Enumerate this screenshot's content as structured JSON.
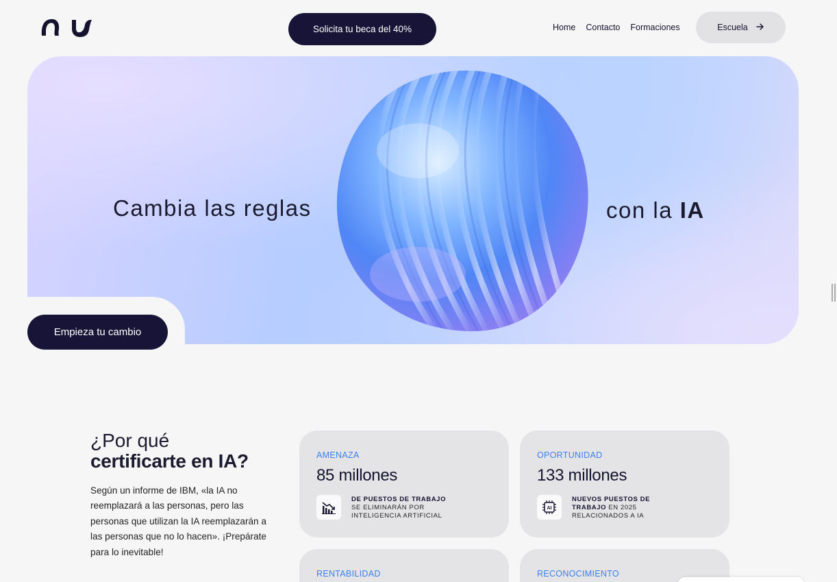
{
  "header": {
    "cta_label": "Solicita tu beca del 40%",
    "nav": [
      "Home",
      "Contacto",
      "Formaciones"
    ],
    "escuela_label": "Escuela",
    "escuela_icon": "arrow-right-icon"
  },
  "hero": {
    "left_text": "Cambia las reglas",
    "right_text_prefix": "con la",
    "right_text_bold": "IA",
    "cta_label": "Empieza tu cambio"
  },
  "why": {
    "title_line1": "¿Por qué",
    "title_line2": "certificarte en IA?",
    "text": "Según un informe de IBM, «la IA no reemplazará a las personas, pero las personas que utilizan la IA reemplazarán a las personas que no lo hacen». ¡Prepárate para lo inevitable!"
  },
  "cards": [
    {
      "tag": "AMENAZA",
      "value": "85 millones",
      "icon": "chart-down-icon",
      "desc_bold": "DE PUESTOS DE TRABAJO",
      "desc_rest": "SE ELIMINARÁN POR INTELIGENCIA ARTIFICIAL"
    },
    {
      "tag": "OPORTUNIDAD",
      "value": "133 millones",
      "icon": "ai-chip-icon",
      "desc_bold": "NUEVOS PUESTOS DE TRABAJO",
      "desc_rest": "EN 2025 RELACIONADOS A IA"
    },
    {
      "tag": "RENTABILIDAD"
    },
    {
      "tag": "RECONOCIMIENTO"
    }
  ],
  "colors": {
    "primary_dark": "#171438",
    "accent_blue": "#3a7ef0",
    "card_bg": "#e4e4e6",
    "page_bg": "#f6f6f6"
  }
}
